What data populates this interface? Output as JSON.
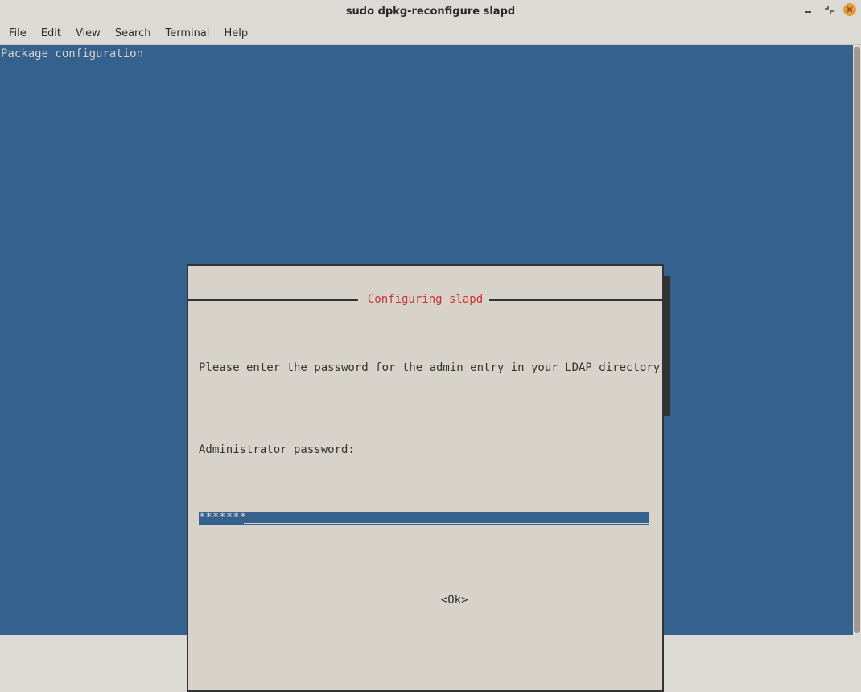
{
  "window": {
    "title": "sudo dpkg-reconfigure slapd"
  },
  "menu": {
    "file": "File",
    "edit": "Edit",
    "view": "View",
    "search": "Search",
    "terminal": "Terminal",
    "help": "Help"
  },
  "terminal": {
    "top_label": "Package configuration"
  },
  "dialog": {
    "title": " Configuring slapd ",
    "prompt": "Please enter the password for the admin entry in your LDAP directory.",
    "field_label": "Administrator password:",
    "password_value": "*******",
    "ok_label": "<Ok>"
  }
}
